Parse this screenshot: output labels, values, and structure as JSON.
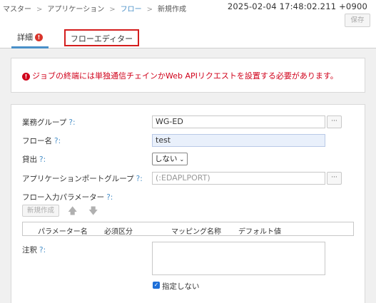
{
  "breadcrumb": {
    "items": [
      "マスター",
      "アプリケーション",
      "フロー",
      "新規作成"
    ],
    "separator": ">"
  },
  "timestamp": "2025-02-04 17:48:02.211 +0900",
  "toolbar": {
    "save_label": "保存"
  },
  "tabs": [
    {
      "label": "詳細",
      "badge": "!",
      "active": true
    },
    {
      "label": "フローエディター",
      "active": false
    }
  ],
  "alert": {
    "icon": "!",
    "message": "ジョブの終端には単独通信チェインかWeb APIリクエストを設置する必要があります。"
  },
  "form": {
    "help_mark": "?:",
    "group": {
      "label": "業務グループ",
      "value": "WG-ED",
      "button": "···"
    },
    "flow_name": {
      "label": "フロー名",
      "value": "test"
    },
    "lend": {
      "label": "貸出",
      "value": "しない",
      "chevron": "⌄"
    },
    "port_group": {
      "label": "アプリケーションポートグループ",
      "placeholder": "(:EDAPLPORT)",
      "button": "···"
    },
    "params": {
      "label": "フロー入力パラメーター",
      "new_label": "新規作成",
      "columns": [
        "パラメーター名",
        "必須区分",
        "マッピング名称",
        "デフォルト値"
      ]
    },
    "note": {
      "label": "注釈",
      "checkbox_label": "指定しない",
      "checked": true
    }
  },
  "colors": {
    "accent": "#4a90c8",
    "error": "#d0021b",
    "highlight_border": "#d41e1e"
  }
}
